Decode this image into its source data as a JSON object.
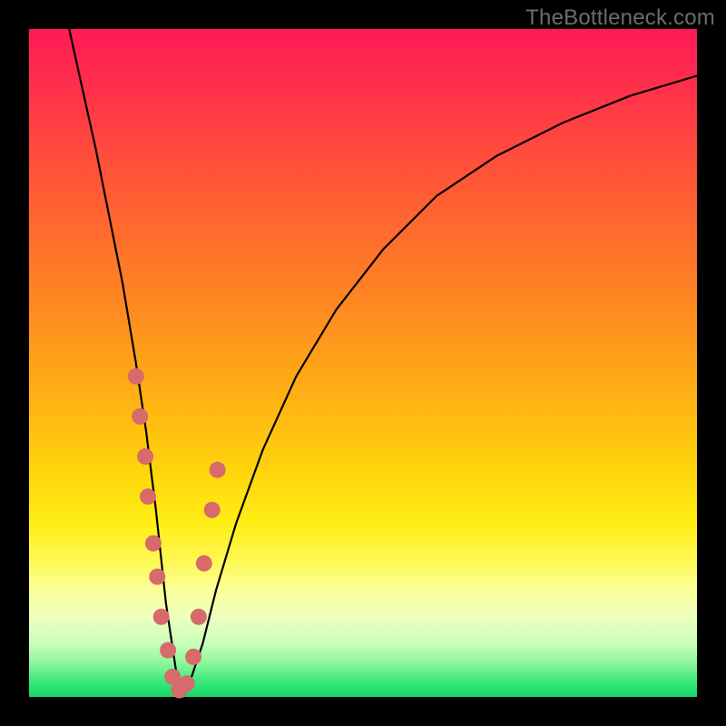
{
  "watermark": "TheBottleneck.com",
  "colors": {
    "frame": "#000000",
    "curve": "#000000",
    "marker": "#d76a6a",
    "gradient_top": "#ff1a55",
    "gradient_bottom": "#16d767"
  },
  "chart_data": {
    "type": "line",
    "title": "",
    "xlabel": "",
    "ylabel": "",
    "xlim": [
      0,
      100
    ],
    "ylim": [
      0,
      100
    ],
    "series": [
      {
        "name": "bottleneck-curve",
        "x": [
          6,
          8,
          10,
          12,
          14,
          16,
          17.5,
          19,
          20.5,
          22,
          23,
          24,
          26,
          28,
          31,
          35,
          40,
          46,
          53,
          61,
          70,
          80,
          90,
          100
        ],
        "values": [
          100,
          91,
          82,
          72,
          62,
          50,
          40,
          28,
          14,
          4,
          0,
          2,
          8,
          16,
          26,
          37,
          48,
          58,
          67,
          75,
          81,
          86,
          90,
          93
        ]
      }
    ],
    "markers": {
      "name": "highlighted-points",
      "x": [
        16.0,
        16.6,
        17.4,
        17.8,
        18.6,
        19.2,
        19.8,
        20.8,
        21.5,
        22.5,
        23.6,
        24.6,
        25.4,
        26.2,
        27.4,
        28.2
      ],
      "values": [
        48,
        42,
        36,
        30,
        23,
        18,
        12,
        7,
        3,
        1,
        2,
        6,
        12,
        20,
        28,
        34
      ],
      "radius": 9
    }
  }
}
